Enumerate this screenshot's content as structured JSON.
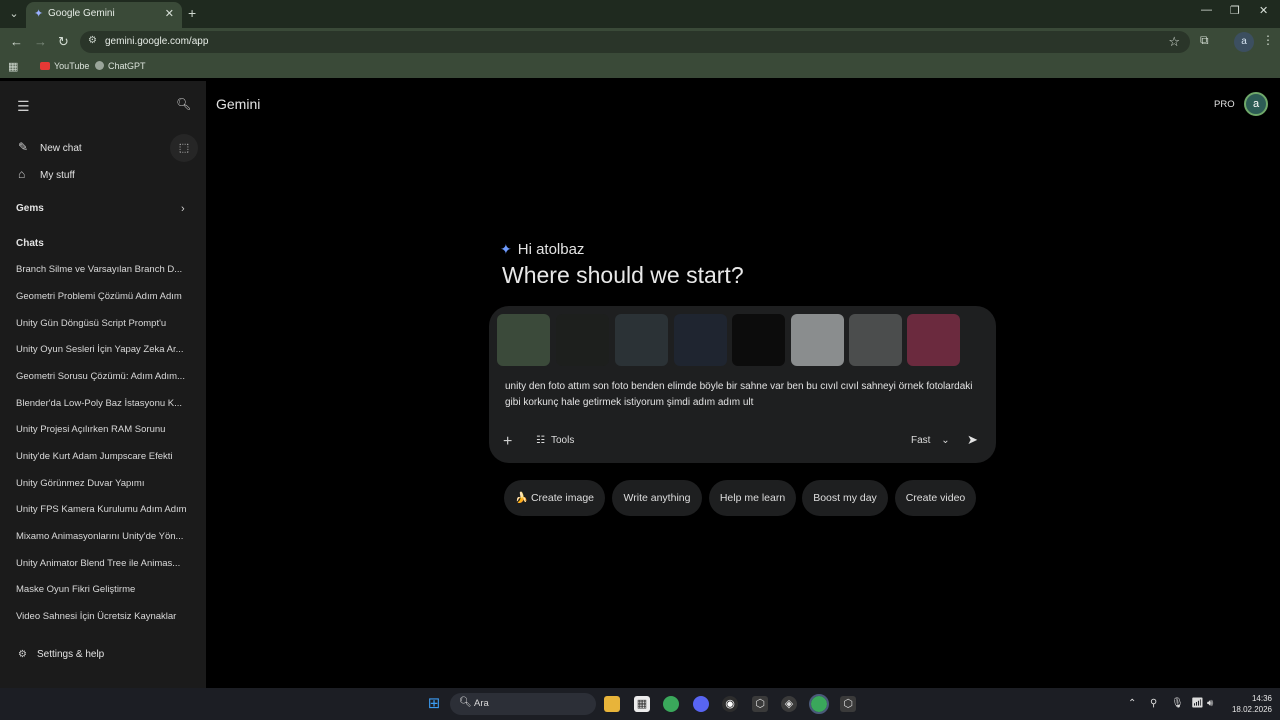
{
  "browser": {
    "tab_title": "Google Gemini",
    "url": "gemini.google.com/app",
    "bookmarks": [
      {
        "label": "YouTube"
      },
      {
        "label": "ChatGPT"
      }
    ],
    "profile_initial": "a"
  },
  "sidebar": {
    "new_chat": "New chat",
    "my_stuff": "My stuff",
    "gems": "Gems",
    "chats_header": "Chats",
    "chats": [
      "Branch Silme ve Varsayılan Branch D...",
      "Geometri Problemi Çözümü Adım Adım",
      "Unity Gün Döngüsü Script Prompt'u",
      "Unity Oyun Sesleri İçin Yapay Zeka Ar...",
      "Geometri Sorusu Çözümü: Adım Adım...",
      "Blender'da Low-Poly Baz İstasyonu K...",
      "Unity Projesi Açılırken RAM Sorunu",
      "Unity'de Kurt Adam Jumpscare Efekti",
      "Unity Görünmez Duvar Yapımı",
      "Unity FPS Kamera Kurulumu Adım Adım",
      "Mixamo Animasyonlarını Unity'de Yön...",
      "Unity Animator Blend Tree ile Animas...",
      "Maske Oyun Fikri Geliştirme",
      "Video Sahnesi İçin Ücretsiz Kaynaklar"
    ],
    "settings": "Settings & help"
  },
  "header": {
    "app_name": "Gemini",
    "plan_badge": "PRO",
    "avatar_initial": "a"
  },
  "main": {
    "greeting": "Hi atolbaz",
    "headline": "Where should we start?",
    "prompt_text": "unity den foto attım son foto benden elimde böyle bir sahne var ben bu cıvıl cıvıl sahneyi örnek fotolardaki gibi korkunç hale getirmek istiyorum şimdi adım adım ult",
    "tools_label": "Tools",
    "mode_label": "Fast",
    "attachments": [
      {
        "icon": "image-thumbnail",
        "color": "#3b4a3a"
      },
      {
        "icon": "image-thumbnail",
        "color": "#1d1f1d"
      },
      {
        "icon": "image-thumbnail",
        "color": "#2b3236"
      },
      {
        "icon": "image-thumbnail",
        "color": "#1f2530"
      },
      {
        "icon": "image-thumbnail",
        "color": "#0c0c0c"
      },
      {
        "icon": "image-thumbnail",
        "color": "#8a8d8e"
      },
      {
        "icon": "image-thumbnail",
        "color": "#4b4d4d"
      },
      {
        "icon": "image-thumbnail",
        "color": "#6b2a3e"
      }
    ],
    "chips": [
      {
        "label": "🍌 Create image"
      },
      {
        "label": "Write anything"
      },
      {
        "label": "Help me learn"
      },
      {
        "label": "Boost my day"
      },
      {
        "label": "Create video"
      }
    ]
  },
  "taskbar": {
    "search_label": "Ara",
    "time": "14:36",
    "date": "18.02.2026"
  }
}
